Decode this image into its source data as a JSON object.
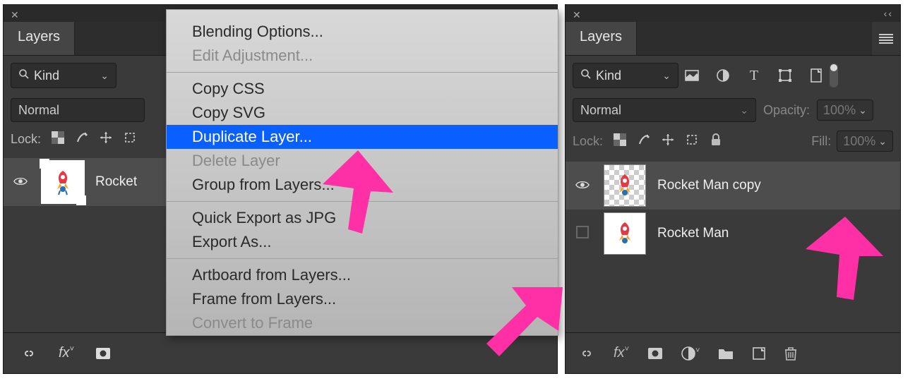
{
  "left": {
    "tab": "Layers",
    "filter": {
      "kind": "Kind"
    },
    "blend": "Normal",
    "lock_label": "Lock:",
    "layer": {
      "name": "Rocket"
    },
    "context_menu": {
      "blending": "Blending Options...",
      "edit_adj": "Edit Adjustment...",
      "copy_css": "Copy CSS",
      "copy_svg": "Copy SVG",
      "duplicate": "Duplicate Layer...",
      "delete": "Delete Layer",
      "group": "Group from Layers...",
      "quick_export": "Quick Export as JPG",
      "export_as": "Export As...",
      "artboard": "Artboard from Layers...",
      "frame": "Frame from Layers...",
      "convert": "Convert to Frame"
    }
  },
  "right": {
    "tab": "Layers",
    "filter": {
      "kind": "Kind"
    },
    "blend": "Normal",
    "opacity_label": "Opacity:",
    "opacity_value": "100%",
    "lock_label": "Lock:",
    "fill_label": "Fill:",
    "fill_value": "100%",
    "layers": [
      {
        "name": "Rocket Man copy",
        "visible": true,
        "selected": true,
        "checker": true
      },
      {
        "name": "Rocket Man",
        "visible": false,
        "selected": false,
        "checker": false
      }
    ]
  }
}
